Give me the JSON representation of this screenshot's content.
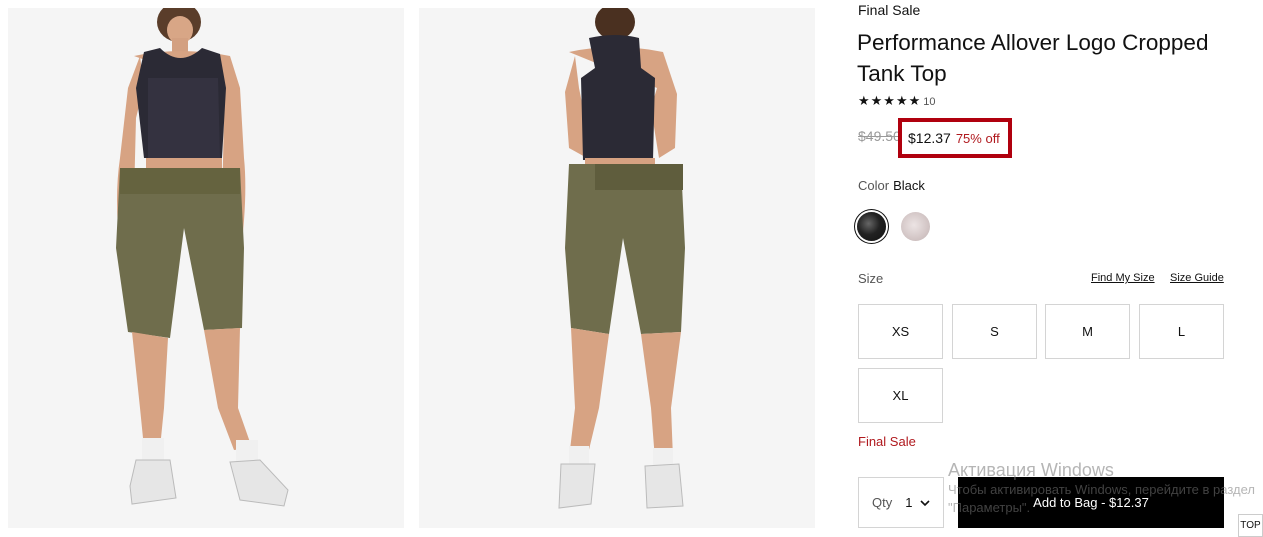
{
  "product": {
    "final_sale_tag": "Final Sale",
    "title": "Performance Allover Logo Cropped Tank Top",
    "rating_stars": "★★★★★",
    "rating_value": 5,
    "review_count": "10",
    "original_price": "$49.50",
    "sale_price": "$12.37",
    "discount": "75% off"
  },
  "color": {
    "label": "Color",
    "selected": "Black",
    "swatches": [
      "black-swatch",
      "blush-swatch"
    ]
  },
  "size": {
    "label": "Size",
    "find_my_size": "Find My Size",
    "size_guide": "Size Guide",
    "options": [
      "XS",
      "S",
      "M",
      "L",
      "XL"
    ]
  },
  "final_sale_notice": "Final Sale",
  "cart": {
    "qty_label": "Qty",
    "qty_value": "1",
    "add_to_bag": "Add to Bag  -  $12.37"
  },
  "top_button": "TOP",
  "watermark": {
    "title": "Активация Windows",
    "subtitle": "Чтобы активировать Windows, перейдите в раздел \"Параметры\"."
  },
  "colors": {
    "sale_red": "#b0191e",
    "highlight_border": "#b0000e",
    "button_black": "#000000"
  }
}
